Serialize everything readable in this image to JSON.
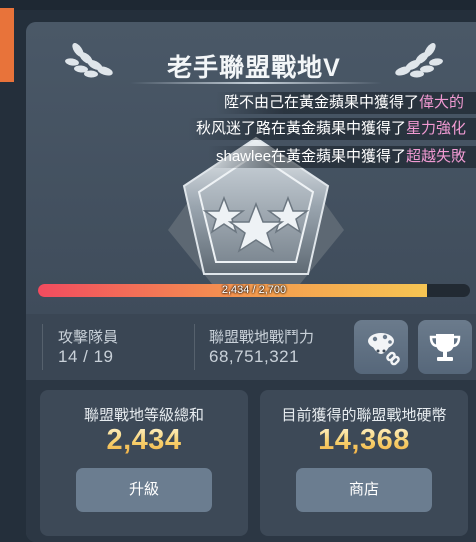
{
  "header": {
    "title": "老手聯盟戰地V"
  },
  "feed": [
    {
      "prefix": "陞不由己在黃金蘋果中獲得了",
      "item": "偉大的"
    },
    {
      "prefix": "秋风迷了路在黃金蘋果中獲得了",
      "item": "星力強化"
    },
    {
      "prefix": "shawlee在黃金蘋果中獲得了",
      "item": "超越失敗"
    }
  ],
  "progress": {
    "current": 2434,
    "max": 2700,
    "text": "2,434 / 2,700"
  },
  "stats": {
    "members_label": "攻擊隊員",
    "members_value": "14 / 19",
    "power_label": "聯盟戰地戰鬥力",
    "power_value": "68,751,321"
  },
  "icons": {
    "character": "character-link-icon",
    "trophy": "trophy-icon",
    "emblem": "three-star-rank-emblem-icon",
    "laurel": "laurel-icon"
  },
  "cards": {
    "level_sum": {
      "label": "聯盟戰地等級總和",
      "value": "2,434",
      "button": "升級"
    },
    "coins": {
      "label": "目前獲得的聯盟戰地硬幣",
      "value": "14,368",
      "button": "商店"
    }
  },
  "colors": {
    "accent_orange": "#e8733a",
    "highlight_pink": "#f09ad2",
    "gold": "#f7cf6b",
    "progress_start": "#f24b5f",
    "progress_end": "#f6c553"
  }
}
